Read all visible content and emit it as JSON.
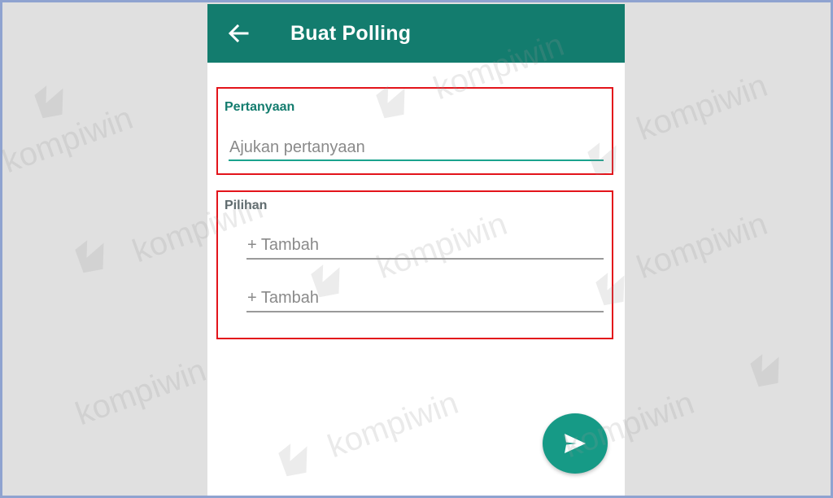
{
  "appbar": {
    "title": "Buat Polling",
    "back_icon": "arrow-left-icon"
  },
  "question": {
    "label": "Pertanyaan",
    "placeholder": "Ajukan pertanyaan"
  },
  "options": {
    "label": "Pilihan",
    "items": [
      {
        "placeholder": "+ Tambah"
      },
      {
        "placeholder": "+ Tambah"
      }
    ]
  },
  "send_button": {
    "icon": "send-icon"
  },
  "watermark": {
    "text": "kompiwin"
  },
  "colors": {
    "appbar": "#137c6e",
    "accent": "#1aa38e",
    "fab": "#169a86",
    "highlight": "#e3141b",
    "frame": "#8fa3d0"
  }
}
